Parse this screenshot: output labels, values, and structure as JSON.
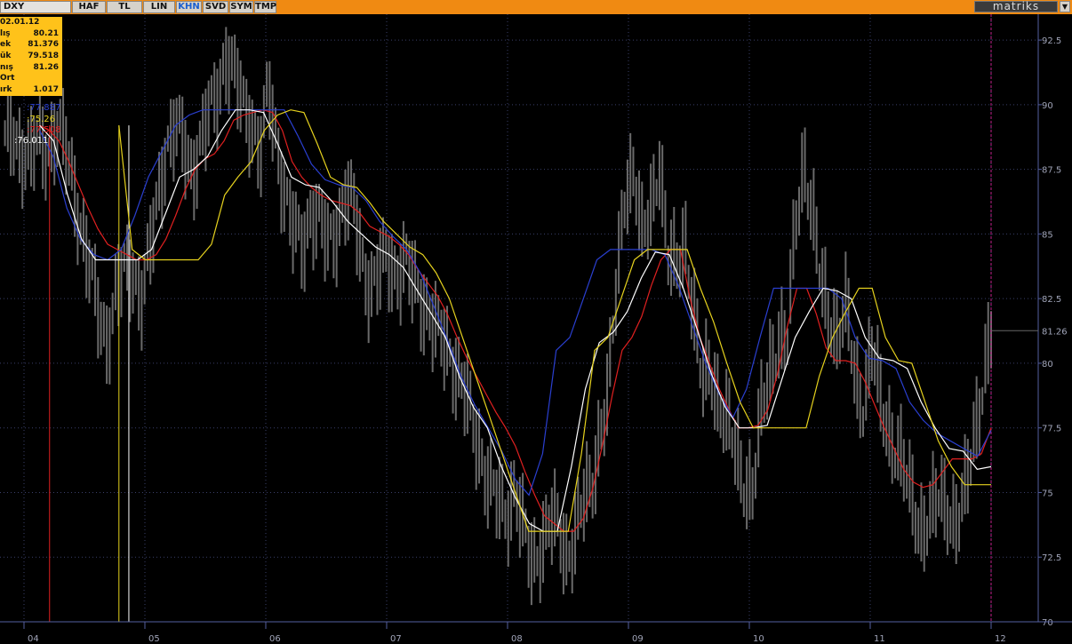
{
  "toolbar": {
    "symbol": "DXY",
    "tabs": [
      "HAF",
      "TL",
      "LIN",
      "KHN",
      "SVD",
      "SYM",
      "TMP"
    ],
    "active_tab": "KHN",
    "brand": "matriks",
    "dropdown_glyph": "▼"
  },
  "infobox": {
    "date": "02.01.12",
    "rows": [
      {
        "label": "lış",
        "value": "80.21"
      },
      {
        "label": "ek",
        "value": "81.376"
      },
      {
        "label": "ük",
        "value": "79.518"
      },
      {
        "label": "nış",
        "value": "81.26"
      },
      {
        "label": "Ort",
        "value": ""
      },
      {
        "label": "ırk",
        "value": "1.017"
      }
    ]
  },
  "indicator_labels": [
    {
      "text": ":77.887",
      "color": "#2a3fd0"
    },
    {
      "text": ":75.26",
      "color": "#e6d21e"
    },
    {
      "text": ":77.508",
      "color": "#e02020"
    },
    {
      "text": ":76.011",
      "color": "#ffffff"
    }
  ],
  "chart_data": {
    "type": "line",
    "ylim": [
      70,
      93.5
    ],
    "y_ticks": [
      "92.5",
      "90",
      "87.5",
      "85",
      "82.5",
      "80",
      "77.5",
      "75",
      "72.5",
      "70"
    ],
    "x_ticks": [
      "04",
      "05",
      "06",
      "07",
      "08",
      "09",
      "10",
      "11",
      "12"
    ],
    "last_price": "81.26",
    "price_values": [
      88.5,
      89.0,
      88.2,
      87.8,
      88.7,
      88.3,
      89.0,
      88.4,
      87.2,
      85.2,
      83.5,
      82.0,
      81.0,
      82.5,
      83.5,
      83.8,
      82.5,
      84.0,
      86.5,
      88.5,
      89.0,
      88.5,
      87.5,
      88.5,
      89.5,
      90.5,
      92.0,
      91.0,
      90.0,
      89.5,
      88.0,
      90.5,
      88.5,
      86.5,
      85.0,
      84.5,
      86.0,
      85.5,
      84.5,
      85.3,
      86.5,
      86.0,
      84.0,
      83.0,
      83.5,
      84.0,
      83.5,
      84.0,
      83.0,
      82.5,
      82.0,
      81.0,
      80.5,
      80.0,
      79.0,
      77.5,
      76.5,
      75.5,
      74.5,
      74.0,
      75.5,
      73.5,
      72.0,
      73.0,
      74.0,
      73.5,
      72.5,
      73.5,
      74.5,
      75.0,
      77.5,
      79.0,
      83.0,
      87.0,
      87.5,
      84.5,
      86.0,
      88.0,
      84.0,
      83.5,
      85.0,
      82.0,
      79.0,
      80.0,
      78.5,
      77.5,
      76.5,
      75.5,
      75.0,
      78.0,
      80.0,
      81.0,
      80.5,
      85.5,
      88.0,
      85.5,
      83.0,
      82.0,
      81.0,
      82.0,
      79.5,
      78.5,
      80.5,
      78.5,
      77.5,
      76.5,
      75.5,
      74.5,
      73.5,
      74.0,
      75.0,
      74.5,
      73.5,
      75.0,
      77.5,
      79.0,
      81.0
    ],
    "series": [
      {
        "color": "#e02020",
        "values": [
          89.2,
          89.0,
          88.6,
          87.8,
          86.9,
          86.0,
          85.2,
          84.6,
          84.4,
          84.2,
          84.0,
          84.0,
          84.2,
          84.8,
          85.7,
          86.7,
          87.5,
          87.9,
          88.1,
          88.6,
          89.4,
          89.6,
          89.7,
          89.8,
          89.7,
          89.0,
          87.8,
          87.2,
          86.8,
          86.5,
          86.3,
          86.2,
          86.1,
          85.8,
          85.3,
          85.1,
          84.9,
          84.6,
          84.2,
          83.6,
          83.1,
          82.6,
          81.9,
          81.0,
          80.2,
          79.5,
          78.8,
          78.1,
          77.5,
          76.8,
          75.8,
          74.9,
          74.1,
          73.8,
          73.5,
          73.5,
          74.0,
          75.2,
          76.9,
          78.8,
          80.5,
          81.0,
          81.8,
          83.0,
          84.0,
          84.4,
          84.4,
          82.5,
          81.0,
          80.0,
          79.0,
          78.2,
          77.5,
          77.5,
          77.6,
          78.2,
          79.6,
          81.4,
          82.9,
          82.9,
          81.9,
          80.6,
          80.1,
          80.1,
          80.0,
          79.3,
          78.4,
          77.5,
          76.7,
          75.9,
          75.4,
          75.2,
          75.3,
          75.8,
          76.3,
          76.3,
          76.3,
          76.5,
          77.5
        ]
      },
      {
        "color": "#2a3fd0",
        "values": [
          89.0,
          88.0,
          86.0,
          84.8,
          84.2,
          84.0,
          84.4,
          85.7,
          87.2,
          88.2,
          89.2,
          89.6,
          89.8,
          89.8,
          89.8,
          89.8,
          89.8,
          89.8,
          89.8,
          88.8,
          87.7,
          87.1,
          86.9,
          86.8,
          86.3,
          85.5,
          84.9,
          84.4,
          83.5,
          82.2,
          80.9,
          79.5,
          78.4,
          77.5,
          76.6,
          75.5,
          74.9,
          76.5,
          80.5,
          81.0,
          82.5,
          84.0,
          84.4,
          84.4,
          84.4,
          84.4,
          84.2,
          83.0,
          81.5,
          80.0,
          78.8,
          77.9,
          79.0,
          81.0,
          82.9,
          82.9,
          82.9,
          82.9,
          82.9,
          82.5,
          81.0,
          80.2,
          80.1,
          79.8,
          78.5,
          77.8,
          77.3,
          77.0,
          76.7,
          76.4,
          77.4
        ]
      },
      {
        "color": "#ffffff",
        "values": [
          89.2,
          88.6,
          86.5,
          84.8,
          84.0,
          84.0,
          84.0,
          84.0,
          84.4,
          85.8,
          87.2,
          87.5,
          88.0,
          89.0,
          89.8,
          89.8,
          89.7,
          88.5,
          87.2,
          86.9,
          86.8,
          86.2,
          85.5,
          85.0,
          84.5,
          84.2,
          83.7,
          82.8,
          81.9,
          81.0,
          79.5,
          78.3,
          77.5,
          76.0,
          74.8,
          73.8,
          73.5,
          73.5,
          76.0,
          79.0,
          80.8,
          81.2,
          82.0,
          83.3,
          84.3,
          84.2,
          82.9,
          81.3,
          79.6,
          78.3,
          77.5,
          77.5,
          77.6,
          79.3,
          81.0,
          82.0,
          82.9,
          82.8,
          82.5,
          81.0,
          80.2,
          80.1,
          79.8,
          78.5,
          77.5,
          76.7,
          76.6,
          75.9,
          76.0
        ]
      },
      {
        "color": "#e6d21e",
        "values": [
          89.2,
          84.4,
          84.0,
          84.0,
          84.0,
          84.0,
          84.0,
          84.6,
          86.5,
          87.2,
          87.8,
          89.0,
          89.6,
          89.8,
          89.7,
          88.5,
          87.2,
          86.9,
          86.8,
          86.2,
          85.5,
          85.0,
          84.5,
          84.2,
          83.5,
          82.5,
          81.0,
          79.5,
          78.0,
          76.5,
          75.0,
          73.5,
          73.5,
          73.5,
          73.5,
          76.5,
          80.5,
          81.0,
          82.5,
          84.0,
          84.4,
          84.4,
          84.4,
          84.4,
          82.9,
          81.6,
          80.0,
          78.5,
          77.5,
          77.5,
          77.5,
          77.5,
          77.5,
          79.5,
          81.0,
          82.0,
          82.9,
          82.9,
          81.0,
          80.1,
          80.0,
          78.5,
          77.0,
          76.0,
          75.3,
          75.3,
          75.3
        ]
      }
    ],
    "vertical_markers": [
      {
        "at": 0.05,
        "color": "#e02020",
        "top_value": 89.2
      },
      {
        "at": 0.12,
        "color": "#e6d21e",
        "top_value": 89.2
      },
      {
        "at": 0.13,
        "color": "#ffffff",
        "top_value": 89.2
      },
      {
        "at": 1.0,
        "color": "#c0208a",
        "top_value": 93.5
      }
    ]
  }
}
